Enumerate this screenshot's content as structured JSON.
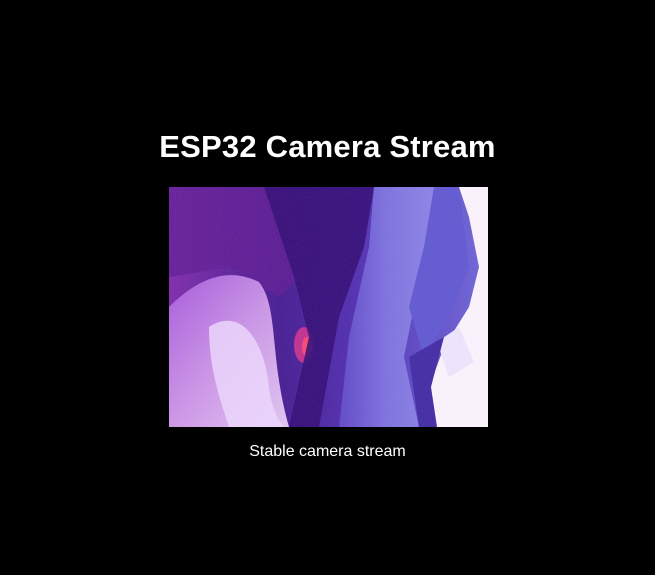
{
  "page": {
    "title": "ESP32 Camera Stream",
    "caption": "Stable camera stream",
    "background_color": "#000000",
    "text_color": "#ffffff"
  },
  "stream": {
    "description_icon": "camera-stream-image"
  }
}
